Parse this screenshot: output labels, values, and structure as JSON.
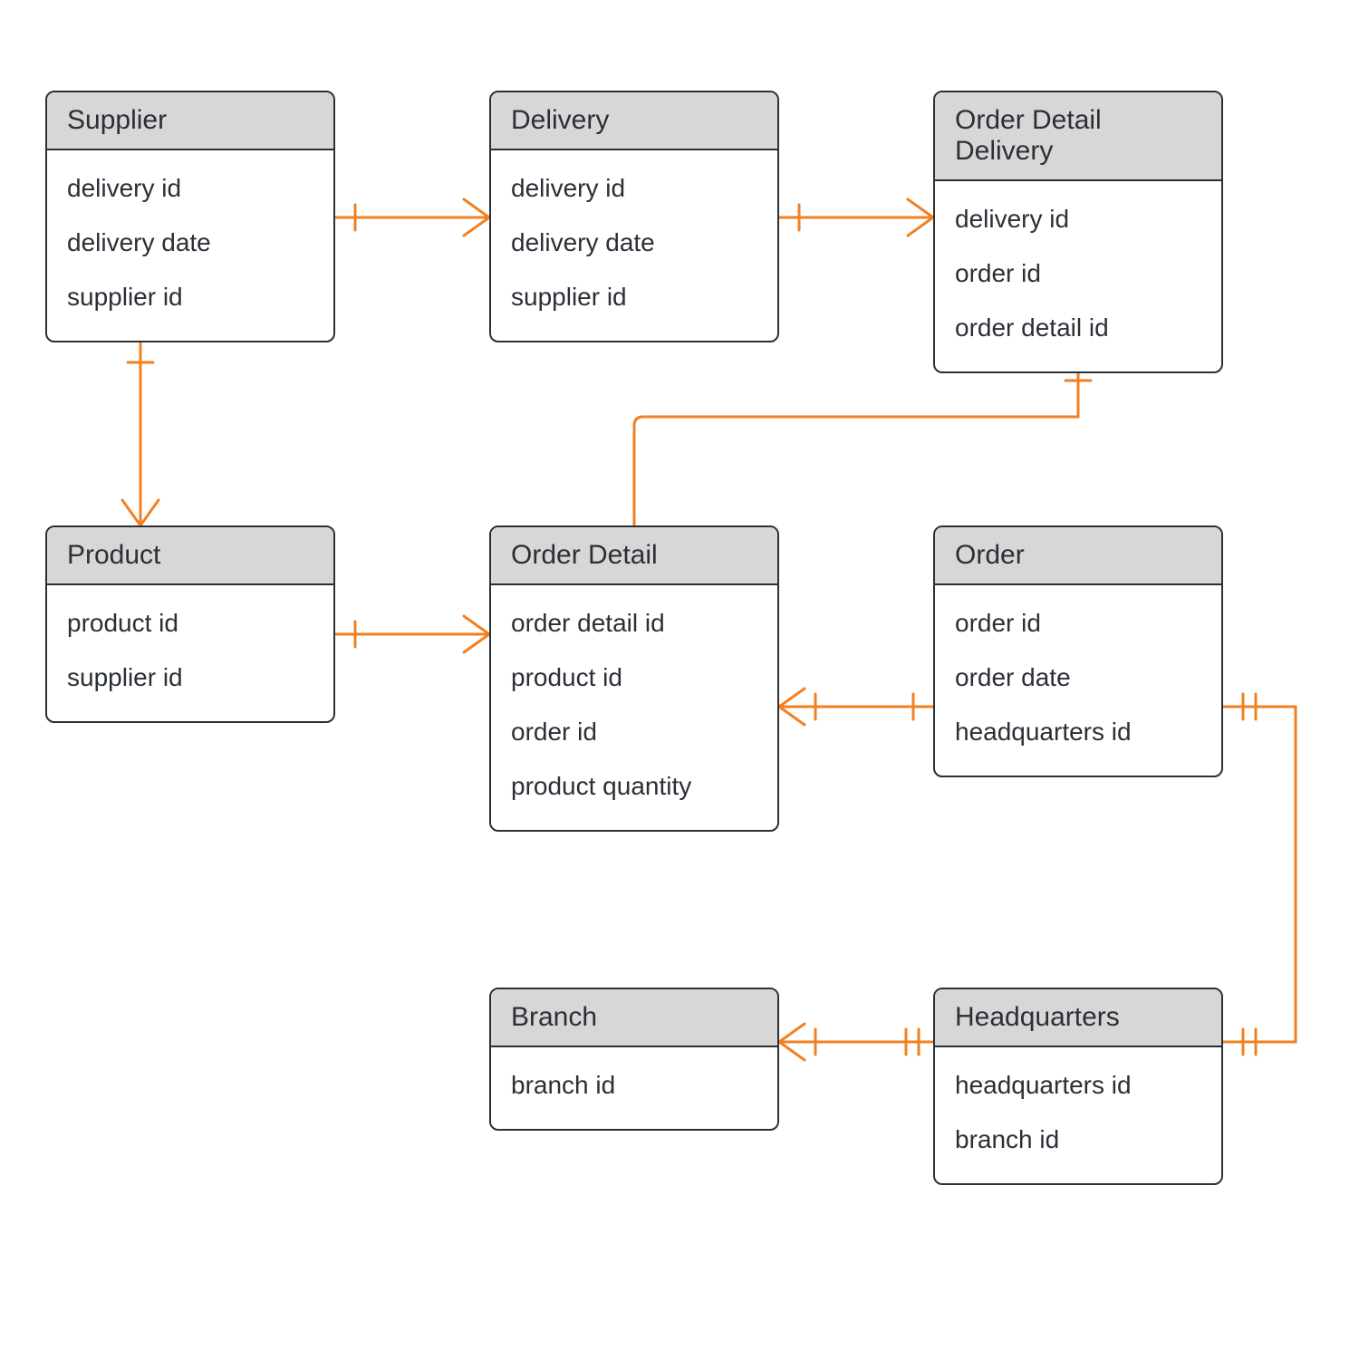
{
  "colors": {
    "connector": "#f28021",
    "box_border": "#2b2f36",
    "title_bg": "#d7d7d7"
  },
  "entities": {
    "supplier": {
      "title": "Supplier",
      "attrs": [
        "delivery id",
        "delivery date",
        "supplier id"
      ]
    },
    "delivery": {
      "title": "Delivery",
      "attrs": [
        "delivery id",
        "delivery date",
        "supplier id"
      ]
    },
    "order_detail_delivery": {
      "title": "Order Detail Delivery",
      "attrs": [
        "delivery id",
        "order id",
        "order detail id"
      ]
    },
    "product": {
      "title": "Product",
      "attrs": [
        "product id",
        "supplier id"
      ]
    },
    "order_detail": {
      "title": "Order Detail",
      "attrs": [
        "order detail id",
        "product id",
        "order id",
        "product quantity"
      ]
    },
    "order": {
      "title": "Order",
      "attrs": [
        "order id",
        "order date",
        "headquarters id"
      ]
    },
    "branch": {
      "title": "Branch",
      "attrs": [
        "branch id"
      ]
    },
    "headquarters": {
      "title": "Headquarters",
      "attrs": [
        "headquarters id",
        "branch id"
      ]
    }
  },
  "relationships": [
    {
      "from": "supplier",
      "to": "delivery",
      "from_card": "one",
      "to_card": "many"
    },
    {
      "from": "delivery",
      "to": "order_detail_delivery",
      "from_card": "one",
      "to_card": "many"
    },
    {
      "from": "supplier",
      "to": "product",
      "from_card": "one",
      "to_card": "many"
    },
    {
      "from": "product",
      "to": "order_detail",
      "from_card": "one",
      "to_card": "many"
    },
    {
      "from": "order_detail",
      "to": "order_detail_delivery",
      "from_card": "many",
      "to_card": "one"
    },
    {
      "from": "order_detail",
      "to": "order",
      "from_card": "many",
      "to_card": "one"
    },
    {
      "from": "order",
      "to": "headquarters",
      "from_card": "one",
      "to_card": "one"
    },
    {
      "from": "branch",
      "to": "headquarters",
      "from_card": "many",
      "to_card": "one"
    }
  ]
}
